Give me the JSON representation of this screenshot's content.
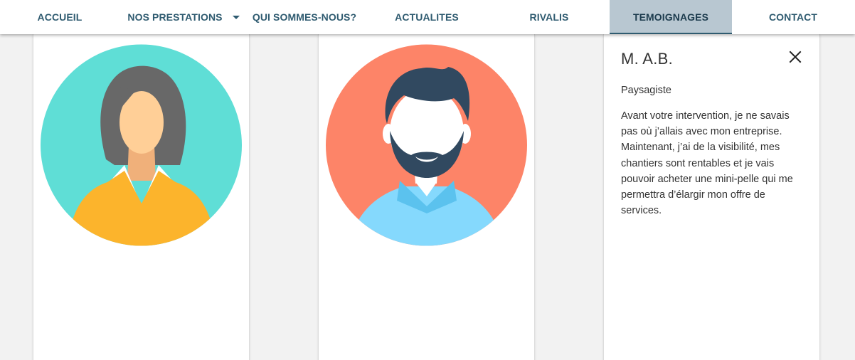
{
  "nav": {
    "items": [
      {
        "label": "ACCUEIL"
      },
      {
        "label": "NOS PRESTATIONS"
      },
      {
        "label": "QUI SOMMES-NOUS?"
      },
      {
        "label": "ACTUALITES"
      },
      {
        "label": "RIVALIS"
      },
      {
        "label": "TEMOIGNAGES",
        "active": true
      },
      {
        "label": "CONTACT"
      }
    ],
    "active_color": "#b8c7d1",
    "text_color": "#2f5b70"
  },
  "cards": [
    {
      "avatar": "woman-avatar-icon",
      "avatar_bg": "#5fded6"
    },
    {
      "avatar": "bearded-man-avatar-icon",
      "avatar_bg": "#fd8468"
    },
    {
      "expanded": true,
      "name": "M. A.B.",
      "role": "Paysagiste",
      "quote": "Avant votre intervention, je ne savais pas où j’allais avec mon entreprise. Maintenant, j’ai de la visibilité, mes chantiers sont rentables et je vais pouvoir acheter une mini-pelle qui me permettra d’élargir mon offre de services.",
      "close_icon": "close-icon"
    }
  ]
}
